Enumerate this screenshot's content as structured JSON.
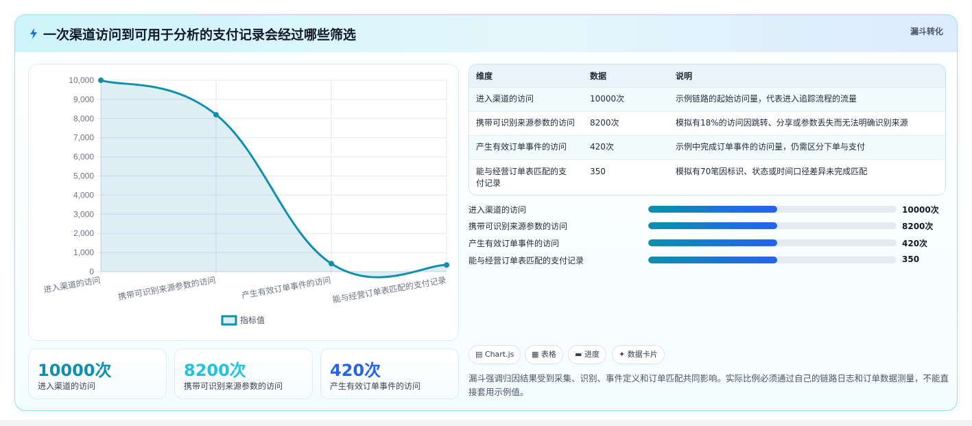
{
  "header": {
    "title": "一次渠道访问到可用于分析的支付记录会经过哪些筛选",
    "badge": "漏斗转化",
    "icon": "lightning-icon"
  },
  "chart_data": {
    "type": "line",
    "categories": [
      "进入渠道的访问",
      "携带可识别来源参数的访问",
      "产生有效订单事件的访问",
      "能与经营订单表匹配的支付记录"
    ],
    "series": [
      {
        "name": "指标值",
        "values": [
          10000,
          8200,
          420,
          350
        ]
      }
    ],
    "ylim": [
      0,
      10000
    ],
    "yticks": [
      "0",
      "1,000",
      "2,000",
      "3,000",
      "4,000",
      "5,000",
      "6,000",
      "7,000",
      "8,000",
      "9,000",
      "10,000"
    ],
    "fill": true,
    "grid": true,
    "legend": "bottom",
    "color": "#0e8fae"
  },
  "kpis": [
    {
      "value": "10000次",
      "label": "进入渠道的访问",
      "color": "#0e8fae"
    },
    {
      "value": "8200次",
      "label": "携带可识别来源参数的访问",
      "color": "#22c4dd"
    },
    {
      "value": "420次",
      "label": "产生有效订单事件的访问",
      "color": "#2563eb"
    }
  ],
  "table": {
    "headers": [
      "维度",
      "数据",
      "说明"
    ],
    "rows": [
      [
        "进入渠道的访问",
        "10000次",
        "示例链路的起始访问量，代表进入追踪流程的流量"
      ],
      [
        "携带可识别来源参数的访问",
        "8200次",
        "模拟有18%的访问因跳转、分享或参数丢失而无法明确识别来源"
      ],
      [
        "产生有效订单事件的访问",
        "420次",
        "示例中完成订单事件的访问量，仍需区分下单与支付"
      ],
      [
        "能与经营订单表匹配的支付记录",
        "350",
        "模拟有70笔因标识、状态或时间口径差异未完成匹配"
      ]
    ]
  },
  "progress": [
    {
      "label": "进入渠道的访问",
      "value": "10000次",
      "fill": 0.52
    },
    {
      "label": "携带可识别来源参数的访问",
      "value": "8200次",
      "fill": 0.52
    },
    {
      "label": "产生有效订单事件的访问",
      "value": "420次",
      "fill": 0.52
    },
    {
      "label": "能与经营订单表匹配的支付记录",
      "value": "350",
      "fill": 0.52
    }
  ],
  "tags": [
    {
      "icon": "chart-icon",
      "label": "▤ Chart.js"
    },
    {
      "icon": "table-icon",
      "label": "▦ 表格"
    },
    {
      "icon": "progress-icon",
      "label": "▬ 进度"
    },
    {
      "icon": "sparkle-icon",
      "label": "✦ 数据卡片"
    }
  ],
  "note": "漏斗强调归因结果受到采集、识别、事件定义和订单匹配共同影响。实际比例必须通过自己的链路日志和订单数据测量，不能直接套用示例值。"
}
